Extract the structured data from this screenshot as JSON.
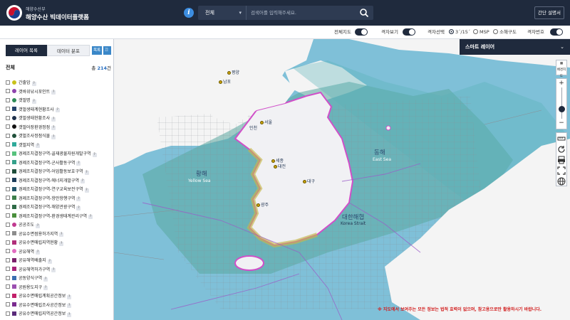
{
  "header": {
    "org": "해양수산부",
    "title": "해양수산 빅데이터플랫폼",
    "search": {
      "category": "전체",
      "placeholder": "검색어를 입력해주세요."
    },
    "guide_label": "간단 설명서"
  },
  "toolbar": {
    "full_map": "전체지도",
    "grid_view": "격자보기",
    "grid_select": "격자선택",
    "grid_options": [
      "3´/15´",
      "MSP",
      "소해구도"
    ],
    "grid_number": "격자번호"
  },
  "panel": {
    "tab_layers": "레이어 목록",
    "tab_distribution": "데이터 분포",
    "btn_list": "목록",
    "btn_close": "끄기",
    "total_label": "전체",
    "total_prefix": "총",
    "total_count": "214",
    "total_suffix": "건",
    "layers": [
      {
        "label": "간출암",
        "color": "#c9c21a",
        "shape": "circle"
      },
      {
        "label": "갯바위낚시포인트",
        "color": "#8e44ad",
        "shape": "circle"
      },
      {
        "label": "갯벌명",
        "color": "#2e8b57",
        "shape": "circle"
      },
      {
        "label": "갯벌생태계현황조사",
        "color": "#26436b",
        "shape": "square"
      },
      {
        "label": "갯벌생태현황조사",
        "color": "#1d2f4a",
        "shape": "circle"
      },
      {
        "label": "갯벌어장환경정점",
        "color": "#111111",
        "shape": "circle"
      },
      {
        "label": "갯벌조사정점식물",
        "color": "#1f4f3a",
        "shape": "circle"
      },
      {
        "label": "갯벌지역",
        "color": "#2faa9a",
        "shape": "square"
      },
      {
        "label": "경제조치결정구역-골재광물자원개발구역",
        "color": "#57c27d",
        "shape": "square"
      },
      {
        "label": "경제조치결정구역-군사활동구역",
        "color": "#35a18b",
        "shape": "square"
      },
      {
        "label": "경제조치결정구역-어업활동보호구역",
        "color": "#1e4d3a",
        "shape": "square"
      },
      {
        "label": "경제조치결정구역-에너지개발구역",
        "color": "#1d3d5a",
        "shape": "square"
      },
      {
        "label": "경제조치결정구역-연구교육보전구역",
        "color": "#24576b",
        "shape": "square"
      },
      {
        "label": "경제조치결정구역-항만항행구역",
        "color": "#3c7f4b",
        "shape": "square"
      },
      {
        "label": "경제조치결정구역-해양관광구역",
        "color": "#2d6a45",
        "shape": "square"
      },
      {
        "label": "경제조치결정구역-환경생태계관리구역",
        "color": "#4a8f3c",
        "shape": "square"
      },
      {
        "label": "공공조도",
        "color": "#c03a8f",
        "shape": "circle"
      },
      {
        "label": "공유수면점용허가지역",
        "color": "#8c8c8c",
        "shape": "square"
      },
      {
        "label": "공유수면매립지역현황",
        "color": "#b02f7a",
        "shape": "square"
      },
      {
        "label": "공유해역",
        "color": "#e26cc0",
        "shape": "circle"
      },
      {
        "label": "공유해역배출지",
        "color": "#7a1f6b",
        "shape": "square"
      },
      {
        "label": "공유해역허가구역",
        "color": "#a8227a",
        "shape": "square"
      },
      {
        "label": "공동양식구역",
        "color": "#3b6fb0",
        "shape": "square"
      },
      {
        "label": "공원용도지구",
        "color": "#9b4fb0",
        "shape": "square"
      },
      {
        "label": "공유수면매립계획공간정보",
        "color": "#c21f6a",
        "shape": "square"
      },
      {
        "label": "공유수면매립조사공간정보",
        "color": "#7a2b8f",
        "shape": "square"
      },
      {
        "label": "공유수면매립지역공간정보",
        "color": "#5a2b7a",
        "shape": "square"
      }
    ]
  },
  "smart_layer": {
    "title": "스마트 레이어"
  },
  "map": {
    "labels": {
      "pyongyang": "평양",
      "nampo": "남포",
      "seoul": "서울",
      "incheon": "인천",
      "sejong": "세종",
      "daejeon": "대전",
      "daegu": "대구",
      "gwangju": "광주",
      "yellow_sea_ko": "황해",
      "yellow_sea_en": "Yellow Sea",
      "east_sea_ko": "동해",
      "east_sea_en": "East Sea",
      "korea_strait_ko": "대한해협",
      "korea_strait_en": "Korea Strait"
    },
    "colors": {
      "ocean": "#7fc0d8",
      "land": "#f4f4f4",
      "coast": "#d04fc8",
      "grid": "#8a8f96"
    }
  },
  "controls": {
    "base_label": "배경지도"
  },
  "disclaimer": "※ 지도에서 보여주는 모든 정보는 법적 효력이 없으며, 참고용으로만 활용하시기 바랍니다."
}
